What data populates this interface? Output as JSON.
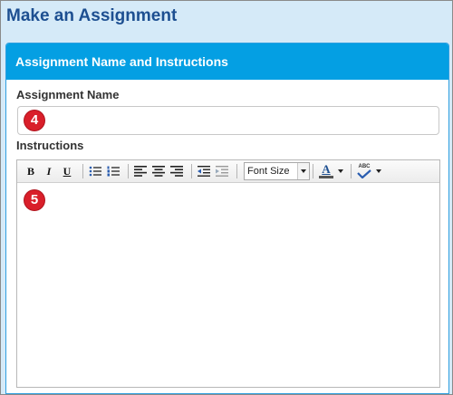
{
  "page": {
    "title": "Make an Assignment"
  },
  "panel": {
    "header": "Assignment Name and Instructions"
  },
  "assignment_name": {
    "label": "Assignment Name",
    "value": "",
    "callout": "4"
  },
  "instructions": {
    "label": "Instructions",
    "value": "",
    "callout": "5"
  },
  "toolbar": {
    "bold": "B",
    "italic": "I",
    "underline": "U",
    "font_size": "Font Size",
    "font_color_letter": "A",
    "spellcheck_text": "ABC"
  },
  "colors": {
    "page_bg": "#d5eaf8",
    "title": "#1d4f91",
    "panel_header": "#049fe3",
    "callout": "#d91f2a"
  }
}
